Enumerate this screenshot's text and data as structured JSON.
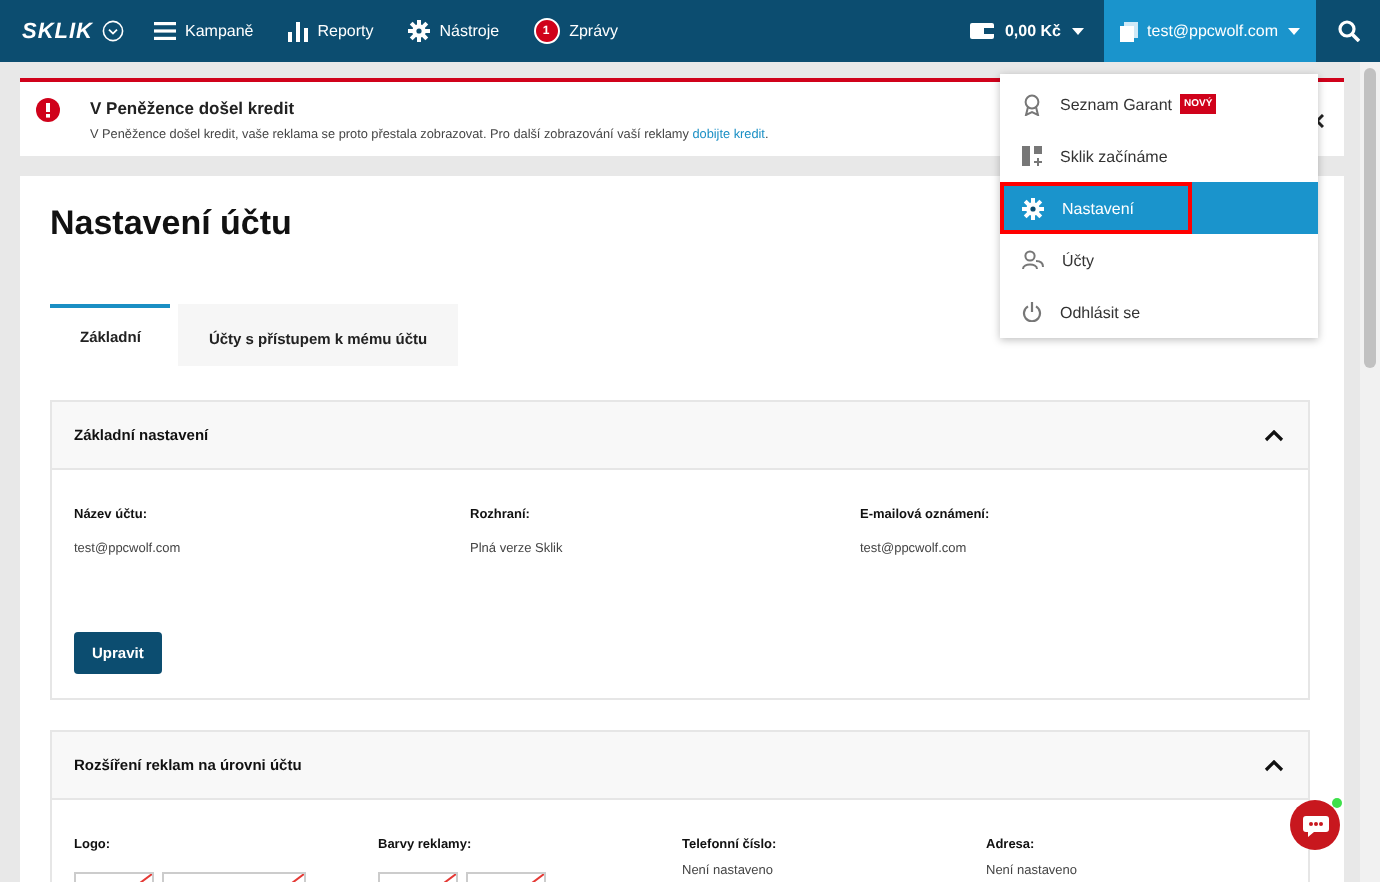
{
  "topbar": {
    "logo": "SKLIK",
    "nav": [
      {
        "label": "Kampaně"
      },
      {
        "label": "Reporty"
      },
      {
        "label": "Nástroje"
      },
      {
        "label": "Zprávy",
        "badge": "1"
      }
    ],
    "wallet": "0,00 Kč",
    "user": "test@ppcwolf.com"
  },
  "alert": {
    "title": "V Peněžence došel kredit",
    "text": "V Peněžence došel kredit, vaše reklama se proto přestala zobrazovat. Pro další zobrazování vaší reklamy",
    "link": "dobijte kredit",
    "text_end": "."
  },
  "user_menu": {
    "items": [
      {
        "label": "Seznam Garant",
        "badge": "NOVÝ",
        "selected": false,
        "outlined": false
      },
      {
        "label": "Sklik začínáme",
        "selected": false,
        "outlined": false
      },
      {
        "label": "Nastavení",
        "selected": true,
        "outlined": true
      },
      {
        "label": "Účty",
        "selected": false,
        "outlined": false
      },
      {
        "label": "Odhlásit se",
        "selected": false,
        "outlined": false
      }
    ]
  },
  "page": {
    "title": "Nastavení účtu",
    "tabs": [
      {
        "label": "Základní",
        "selected": true
      },
      {
        "label": "Účty s přístupem k mému účtu",
        "selected": false
      }
    ],
    "sections": [
      {
        "kind": "fields",
        "title": "Základní nastavení",
        "expanded": true,
        "fields": [
          {
            "label": "Název účtu:",
            "value": "test@ppcwolf.com"
          },
          {
            "label": "Rozhraní:",
            "value": "Plná verze Sklik"
          },
          {
            "label": "E-mailová oznámení:",
            "value": "test@ppcwolf.com"
          }
        ],
        "button": "Upravit"
      },
      {
        "kind": "extensions",
        "title": "Rozšíření reklam na úrovni účtu",
        "expanded": true,
        "columns": [
          {
            "label": "Logo:",
            "kind": "logo"
          },
          {
            "label": "Barvy reklamy:",
            "kind": "colors"
          },
          {
            "label": "Telefonní číslo:",
            "kind": "text",
            "value": "Není nastaveno"
          },
          {
            "label": "Adresa:",
            "kind": "text",
            "value": "Není nastaveno"
          }
        ]
      }
    ]
  }
}
